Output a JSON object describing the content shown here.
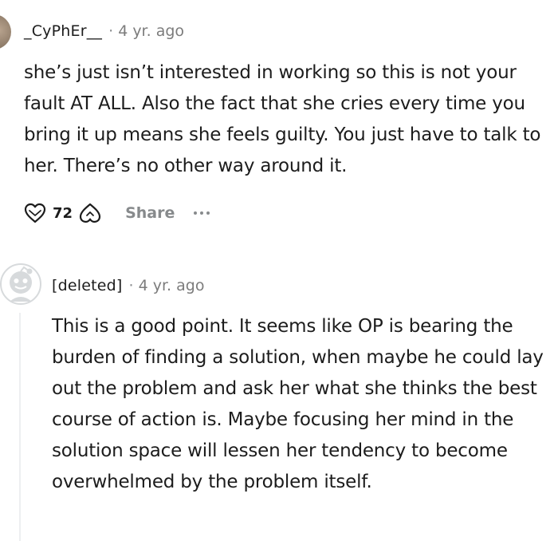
{
  "comment1": {
    "username": "_CyPhEr__",
    "separator": "·",
    "time": "4 yr. ago",
    "body": "she’s just isn’t interested in working so this is not your fault AT ALL. Also the fact that she cries every time you bring it up means she feels guilty. You just have to talk to her. There’s no other way around it.",
    "vote_count": "72",
    "share_label": "Share",
    "upvote_icon": "upvote-icon",
    "downvote_icon": "downvote-icon",
    "more_icon": "more-options-icon"
  },
  "comment2": {
    "username": "[deleted]",
    "separator": "·",
    "time": "4 yr. ago",
    "body": "This is a good point. It seems like OP is bearing the burden of finding a solution, when maybe he could lay out the problem and ask her what she thinks the best course of action is. Maybe focusing her mind in the solution space will lessen her tendency to become overwhelmed by the problem itself.",
    "avatar_icon": "default-avatar-icon"
  },
  "colors": {
    "text": "#1c1c1c",
    "meta": "#7c7c7c",
    "action": "#878a8c",
    "thread_line": "#edeff1",
    "avatar_placeholder": "#d7dadc"
  }
}
